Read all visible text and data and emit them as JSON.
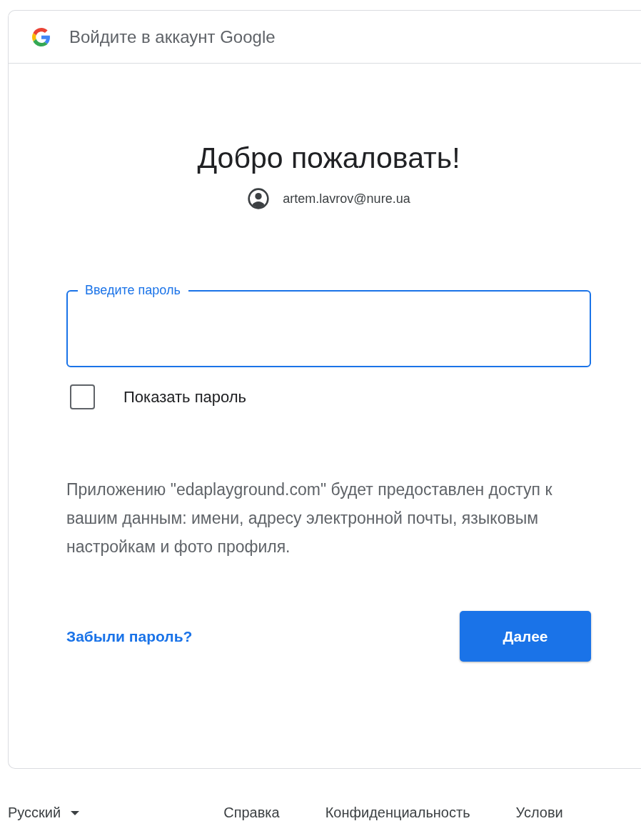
{
  "header": {
    "title": "Войдите в аккаунт Google"
  },
  "heading": "Добро пожаловать!",
  "account": {
    "email": "artem.lavrov@nure.ua"
  },
  "password_field": {
    "label": "Введите пароль",
    "focused": true
  },
  "show_password": {
    "label": "Показать пароль",
    "checked": false
  },
  "consent_text": "Приложению \"edaplayground.com\" будет предоставлен доступ к вашим данным: имени, адресу электронной почты, языковым настройкам и фото профиля.",
  "forgot_link": "Забыли пароль?",
  "next_button": "Далее",
  "footer": {
    "language": "Русский",
    "links": [
      "Справка",
      "Конфиденциальность",
      "Услови"
    ]
  }
}
